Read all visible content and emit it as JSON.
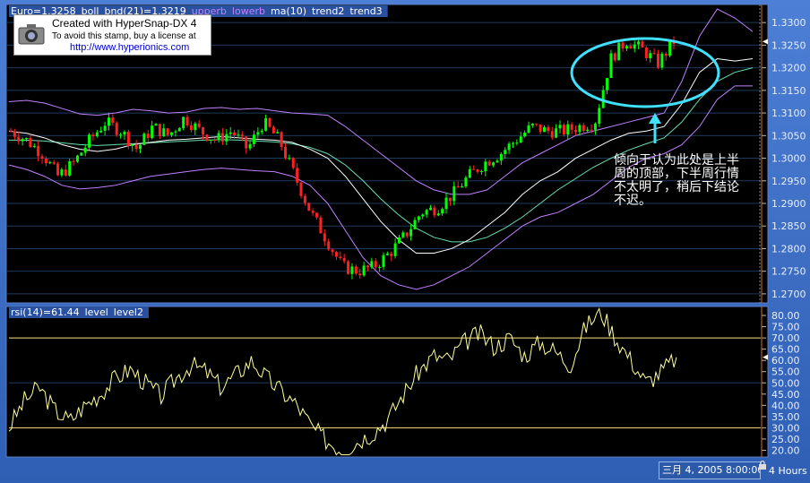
{
  "price_panel": {
    "symbol_value": "Euro=1.3258",
    "indicators": [
      {
        "label": "boll",
        "color": "#ffffff"
      },
      {
        "label": "bnd(21)=1.3219",
        "color": "#ffffff"
      },
      {
        "label": "upperb",
        "color": "#c080ff"
      },
      {
        "label": "lowerb",
        "color": "#c080ff"
      },
      {
        "label": "ma(10)",
        "color": "#ffffff"
      },
      {
        "label": "trend2",
        "color": "#ffffff"
      },
      {
        "label": "trend3",
        "color": "#ffffff"
      }
    ]
  },
  "rsi_panel": {
    "indicators": [
      {
        "label": "rsi(14)=61.44",
        "color": "#ffffff"
      },
      {
        "label": "level",
        "color": "#ffffff"
      },
      {
        "label": "level2",
        "color": "#ffffff"
      }
    ]
  },
  "stamp": {
    "line1": "Created with HyperSnap-DX 4",
    "line2": "To avoid this stamp, buy a license at",
    "line3": "http://www.hyperionics.com"
  },
  "annotation": {
    "text": "倾向于认为此处是上半周的顶部，下半周行情不太明了，稍后下结论不迟。"
  },
  "status": {
    "date": "三月 4, 2005 8:00:00",
    "period": "4 Hours"
  },
  "colors": {
    "background": "#000000",
    "frame": "#3d6fc4",
    "bull": "#00ff00",
    "bear": "#ff2020",
    "bollinger": "#c080ff",
    "ma": "#ffffff",
    "trend2": "#66e0b0",
    "rsi": "#ffff99",
    "level": "#ffe080",
    "ellipse": "#40e0ff"
  },
  "chart_data": [
    {
      "type": "candlestick",
      "series": [
        {
          "name": "upperb",
          "values": [
            1.3125,
            1.3128,
            1.3122,
            1.311,
            1.3098,
            1.3095,
            1.31,
            1.3108,
            1.3105,
            1.31,
            1.3102,
            1.311,
            1.3112,
            1.3108,
            1.311,
            1.3105,
            1.31,
            1.3098,
            1.3095,
            1.307,
            1.304,
            1.301,
            1.298,
            1.295,
            1.293,
            1.292,
            1.292,
            1.293,
            1.296,
            1.299,
            1.301,
            1.303,
            1.305,
            1.306,
            1.307,
            1.308,
            1.309,
            1.31,
            1.317,
            1.327,
            1.333,
            1.331,
            1.328
          ]
        },
        {
          "name": "lowerb",
          "values": [
            1.2985,
            1.2975,
            1.296,
            1.294,
            1.2932,
            1.2935,
            1.294,
            1.295,
            1.296,
            1.2965,
            1.297,
            1.2975,
            1.2978,
            1.2975,
            1.2972,
            1.297,
            1.296,
            1.294,
            1.29,
            1.284,
            1.278,
            1.274,
            1.272,
            1.271,
            1.272,
            1.274,
            1.276,
            1.279,
            1.282,
            1.285,
            1.287,
            1.288,
            1.29,
            1.292,
            1.295,
            1.298,
            1.3,
            1.301,
            1.303,
            1.307,
            1.313,
            1.316,
            1.316
          ]
        },
        {
          "name": "ma(10)",
          "values": [
            1.306,
            1.3055,
            1.3045,
            1.303,
            1.302,
            1.3015,
            1.302,
            1.303,
            1.3035,
            1.304,
            1.3042,
            1.3045,
            1.3048,
            1.3045,
            1.3042,
            1.304,
            1.3035,
            1.302,
            1.3,
            1.296,
            1.291,
            1.286,
            1.282,
            1.279,
            1.279,
            1.28,
            1.282,
            1.285,
            1.288,
            1.292,
            1.295,
            1.297,
            1.3,
            1.302,
            1.304,
            1.3055,
            1.306,
            1.307,
            1.312,
            1.319,
            1.322,
            1.3215,
            1.322
          ]
        },
        {
          "name": "trend2",
          "values": [
            1.304,
            1.304,
            1.3038,
            1.3034,
            1.303,
            1.3028,
            1.303,
            1.3032,
            1.3034,
            1.3036,
            1.3038,
            1.304,
            1.3041,
            1.304,
            1.3038,
            1.3036,
            1.3032,
            1.3024,
            1.301,
            1.2985,
            1.295,
            1.291,
            1.2875,
            1.2845,
            1.2825,
            1.2815,
            1.2815,
            1.2825,
            1.2845,
            1.287,
            1.29,
            1.293,
            1.2955,
            1.298,
            1.3,
            1.3018,
            1.3032,
            1.3045,
            1.308,
            1.313,
            1.317,
            1.319,
            1.32
          ]
        },
        {
          "name": "close",
          "values": [
            1.306,
            1.304,
            1.301,
            1.296,
            1.299,
            1.304,
            1.308,
            1.306,
            1.302,
            1.307,
            1.305,
            1.309,
            1.306,
            1.304,
            1.306,
            1.302,
            1.308,
            1.304,
            1.296,
            1.288,
            1.282,
            1.276,
            1.275,
            1.276,
            1.279,
            1.283,
            1.288,
            1.289,
            1.292,
            1.296,
            1.299,
            1.301,
            1.304,
            1.307,
            1.306,
            1.306,
            1.307,
            1.308,
            1.322,
            1.326,
            1.324,
            1.321,
            1.3258
          ]
        }
      ],
      "ylim": [
        1.268,
        1.334
      ],
      "yticks": [
        "1.3300",
        "1.3250",
        "1.3200",
        "1.3150",
        "1.3100",
        "1.3050",
        "1.3000",
        "1.2950",
        "1.2900",
        "1.2850",
        "1.2800",
        "1.2750",
        "1.2700"
      ]
    },
    {
      "type": "line",
      "series": [
        {
          "name": "rsi(14)",
          "values": [
            30,
            42,
            48,
            38,
            33,
            40,
            45,
            52,
            56,
            50,
            44,
            52,
            58,
            55,
            48,
            54,
            60,
            52,
            46,
            40,
            30,
            24,
            20,
            24,
            28,
            34,
            45,
            55,
            62,
            60,
            68,
            72,
            66,
            70,
            62,
            68,
            64,
            58,
            75,
            82,
            70,
            60,
            50,
            55,
            61.44
          ]
        },
        {
          "name": "level",
          "values": [
            70
          ]
        },
        {
          "name": "level2",
          "values": [
            30
          ]
        }
      ],
      "ylim": [
        17,
        84
      ],
      "yticks": [
        "80.00",
        "75.00",
        "70.00",
        "65.00",
        "60.00",
        "55.00",
        "50.00",
        "45.00",
        "40.00",
        "35.00",
        "30.00",
        "25.00",
        "20.00"
      ]
    }
  ]
}
